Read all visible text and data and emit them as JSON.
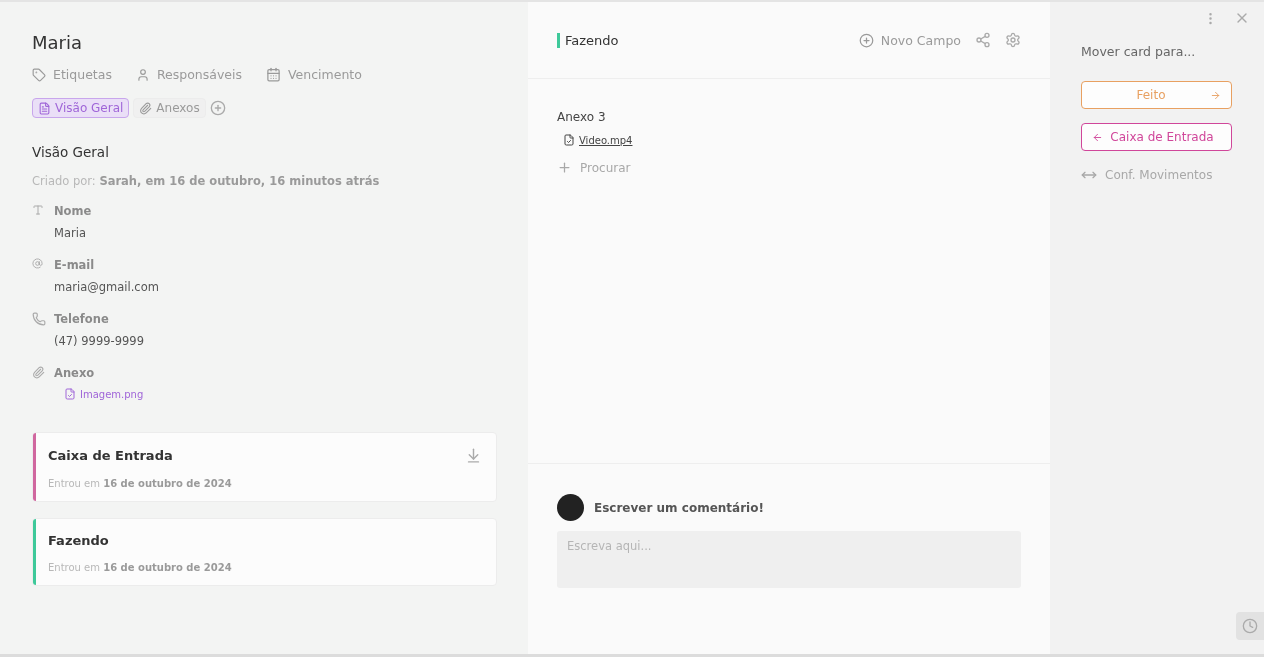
{
  "card": {
    "title": "Maria",
    "meta_actions": [
      {
        "kind": "tag",
        "label": "Etiquetas"
      },
      {
        "kind": "person",
        "label": "Responsáveis"
      },
      {
        "kind": "calendar",
        "label": "Vencimento"
      }
    ],
    "tabs": [
      {
        "kind": "overview",
        "label": "Visão Geral",
        "selected": true
      },
      {
        "kind": "attachments",
        "label": "Anexos",
        "selected": false
      }
    ],
    "section_title": "Visão Geral",
    "created_by": "Criado por: **Sarah, em 16 de outubro, 16 minutos atrás**",
    "fields": [
      {
        "kind": "text",
        "label": "Nome",
        "value": "Maria"
      },
      {
        "kind": "email",
        "label": "E-mail",
        "value": "maria@gmail.com"
      },
      {
        "kind": "phone",
        "label": "Telefone",
        "value": "(47) 9999-9999"
      },
      {
        "kind": "attachment",
        "label": "Anexo",
        "file": "Imagem.png"
      }
    ],
    "phase_history": [
      {
        "name": "Caixa de Entrada",
        "color": "#d0679f",
        "entered": "Entrou em **16 de outubro de 2024**",
        "current": false
      },
      {
        "name": "Fazendo",
        "color": "#3ec99a",
        "entered": "Entrou em **16 de outubro de 2024**",
        "current": true
      }
    ]
  },
  "phase_panel": {
    "phase": "Fazendo",
    "color": "#3ec99a",
    "new_field": "Novo Campo",
    "field_label": "Anexo 3",
    "file": "Video.mp4",
    "search_action": "Procurar",
    "comment_title": "Escrever um comentário!",
    "comment_placeholder": "Escreva aqui..."
  },
  "move_panel": {
    "title": "Mover card para...",
    "targets": [
      {
        "label": "Feito",
        "kind": "forward",
        "color": "#e8a061"
      },
      {
        "label": "Caixa de Entrada",
        "kind": "back",
        "color": "#d0469a"
      }
    ],
    "settings": "Conf. Movimentos"
  }
}
